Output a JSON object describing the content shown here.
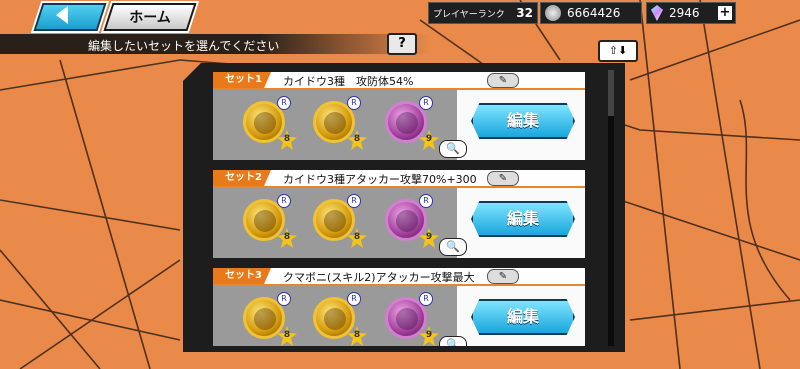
{
  "nav": {
    "home_label": "ホーム",
    "help_label": "?",
    "sort_label": "⇧⬇"
  },
  "status": {
    "rank_label": "プレイヤーランク",
    "rank_value": "32",
    "coins": "6664426",
    "gems": "2946",
    "plus": "+"
  },
  "subtitle": "編集したいセットを選んでください",
  "colors": {
    "accent": "#e87a1c",
    "edit_button": "#1aa6dd",
    "background": "#e98a4a"
  },
  "sets": [
    {
      "tag": "セット1",
      "name": "カイドウ3種　攻防体54%",
      "edit_label": "編集",
      "rename_icon": "pencil-icon",
      "medals": [
        {
          "type": "gold",
          "grade": "R",
          "stars": "8"
        },
        {
          "type": "gold",
          "grade": "R",
          "stars": "8"
        },
        {
          "type": "purple",
          "grade": "R",
          "stars": "9"
        }
      ]
    },
    {
      "tag": "セット2",
      "name": "カイドウ3種アタッカー攻撃70%+300",
      "edit_label": "編集",
      "rename_icon": "pencil-icon",
      "medals": [
        {
          "type": "gold",
          "grade": "R",
          "stars": "8"
        },
        {
          "type": "gold",
          "grade": "R",
          "stars": "8"
        },
        {
          "type": "purple",
          "grade": "R",
          "stars": "9"
        }
      ]
    },
    {
      "tag": "セット3",
      "name": "クマボニ(スキル2)アタッカー攻撃最大",
      "edit_label": "編集",
      "rename_icon": "pencil-icon",
      "medals": [
        {
          "type": "gold",
          "grade": "R",
          "stars": "8"
        },
        {
          "type": "gold",
          "grade": "R",
          "stars": "8"
        },
        {
          "type": "purple",
          "grade": "R",
          "stars": "9"
        }
      ]
    }
  ]
}
